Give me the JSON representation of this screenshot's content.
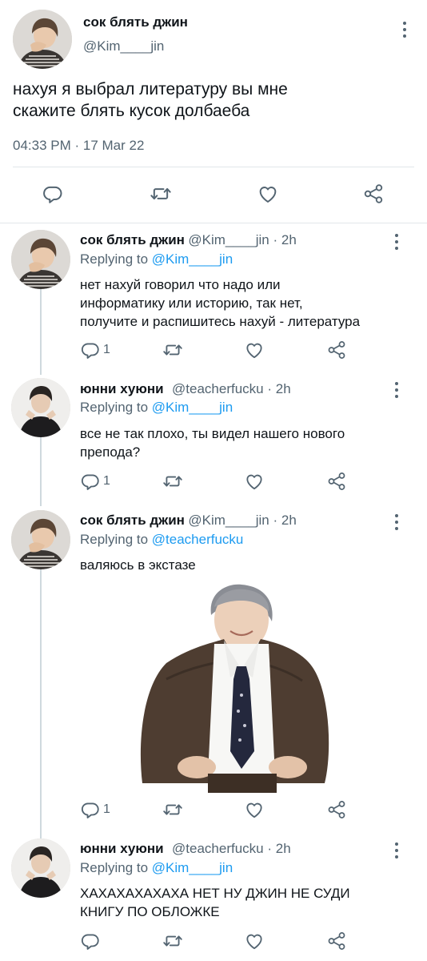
{
  "main_tweet": {
    "display_name": "сок блять джин",
    "handle": "@Kim____jin",
    "text_line1": "нахуя я выбрал литературу вы мне",
    "text_line2": "скажите блять кусок долбаеба",
    "timestamp": "04:33 PM · 17 Mar 22"
  },
  "replies": [
    {
      "display_name": "сок блять джин",
      "handle": "@Kim____jin · 2h",
      "replying_prefix": "Replying to ",
      "replying_to": "@Kim____jin",
      "lines": [
        "нет нахуй говорил что надо или",
        "информатику или историю, так нет,",
        "получите и распишитесь нахуй - литература"
      ],
      "reply_count": "1"
    },
    {
      "display_name": "юнни хуюни",
      "handle": "@teacherfucku · 2h",
      "replying_prefix": "Replying to ",
      "replying_to": "@Kim____jin",
      "lines": [
        "все не так плохо, ты видел нашего нового",
        "препода?"
      ],
      "reply_count": "1"
    },
    {
      "display_name": "сок блять джин",
      "handle": "@Kim____jin · 2h",
      "replying_prefix": "Replying to ",
      "replying_to": "@teacherfucku",
      "lines": [
        "валяюсь в экстазе"
      ],
      "reply_count": "1"
    },
    {
      "display_name": "юнни хуюни",
      "handle": "@teacherfucku · 2h",
      "replying_prefix": "Replying to ",
      "replying_to": "@Kim____jin",
      "lines": [
        "ХАХАХАХАХАХА НЕТ НУ ДЖИН НЕ СУДИ",
        "КНИГУ ПО ОБЛОЖКЕ"
      ],
      "reply_count": ""
    }
  ],
  "icons": [
    "reply-icon",
    "retweet-icon",
    "like-icon",
    "share-icon",
    "more-icon"
  ],
  "colors": {
    "link": "#1d9bf0",
    "secondary": "#536471",
    "text": "#0f1419",
    "divider": "#e1e6ea"
  }
}
